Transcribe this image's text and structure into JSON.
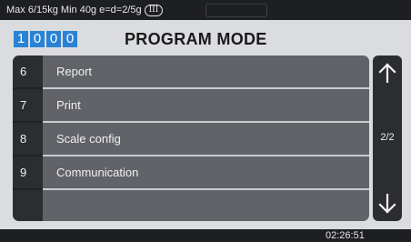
{
  "status_bar": {
    "spec": "Max 6/15kg Min 40g e=d=2/5g",
    "accuracy_class": "III"
  },
  "header": {
    "digits": [
      "1",
      "0",
      "0",
      "0"
    ],
    "title": "PROGRAM MODE"
  },
  "menu": {
    "items": [
      {
        "number": "6",
        "label": "Report"
      },
      {
        "number": "7",
        "label": "Print"
      },
      {
        "number": "8",
        "label": "Scale config"
      },
      {
        "number": "9",
        "label": "Communication"
      },
      {
        "number": "",
        "label": ""
      }
    ]
  },
  "pager": {
    "page": "2/2",
    "up_icon": "arrow-up-icon",
    "down_icon": "arrow-down-icon"
  },
  "footer": {
    "time": "02:26:51"
  },
  "colors": {
    "accent": "#2a82d4",
    "background": "#dadcdf",
    "row": "#616368",
    "number_cell": "#2b2d31"
  }
}
